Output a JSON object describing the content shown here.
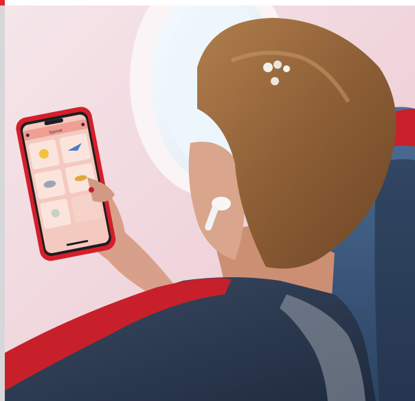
{
  "scene": {
    "colors": {
      "wall": "#f1dde2",
      "window_frame": "#fbf6f8",
      "window_glass": "#e9f3fb",
      "seat_red": "#c8202a",
      "seat_navy": "#27344a",
      "seat_blue": "#3e5d86",
      "hair": "#9a6a3c",
      "skin": "#d7a48b",
      "phone_case": "#d41f2b",
      "phone_screen": "#f4c9bf",
      "accent_red": "#e3262f"
    },
    "phone_screen": {
      "title": "Special",
      "tiles": [
        "",
        "",
        "",
        "",
        ""
      ]
    }
  }
}
